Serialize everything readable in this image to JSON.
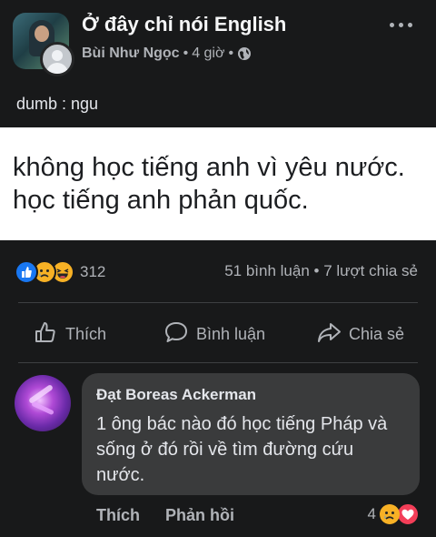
{
  "post": {
    "group_name": "Ở đây chỉ nói English",
    "author": "Bùi Như Ngọc",
    "time": "4 giờ",
    "separator": "•",
    "text": "dumb : ngu",
    "quote_line1": "không học tiếng anh vì yêu nước.",
    "quote_line2": "học tiếng anh phản quốc."
  },
  "stats": {
    "reaction_count": "312",
    "comments": "51 bình luận",
    "shares": "7 lượt chia sẻ",
    "separator": "•"
  },
  "actions": {
    "like": "Thích",
    "comment": "Bình luận",
    "share": "Chia sẻ"
  },
  "comment": {
    "author": "Đạt Boreas Ackerman",
    "text": "1 ông bác nào đó học tiếng Pháp và sống ở đó rồi về tìm đường cứu nước.",
    "like": "Thích",
    "reply": "Phản hồi",
    "reaction_count": "4"
  },
  "colors": {
    "background": "#18191a",
    "bubble": "#3a3b3c",
    "like_blue": "#1877f2",
    "sad_yellow": "#f7b125",
    "love_red": "#f33e58"
  },
  "icons": [
    "globe-icon",
    "more-icon",
    "like-reaction-icon",
    "sad-reaction-icon",
    "haha-reaction-icon",
    "thumbs-up-icon",
    "comment-icon",
    "share-icon",
    "love-reaction-icon"
  ]
}
